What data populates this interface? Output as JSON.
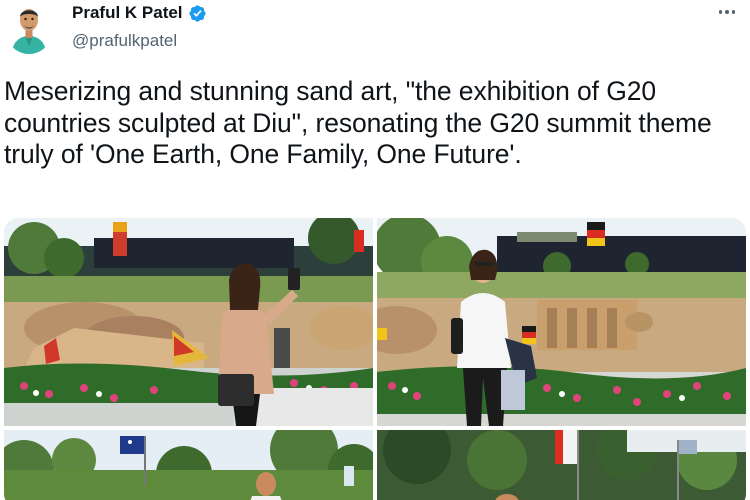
{
  "author": {
    "display_name": "Praful K Patel",
    "handle": "@prafulkpatel",
    "verified": true,
    "avatar_icon": "person-avatar"
  },
  "menu_icon": "more-options-icon",
  "tweet": {
    "text": "Meserizing and stunning sand art, \"the exhibition of G20 countries sculpted at Diu\", resonating the G20 summit theme truly of 'One Earth, One Family, One Future'."
  },
  "media": {
    "count": 4,
    "photos": [
      {
        "id": "photo-1",
        "description_icon": "sand-sculpture-woman-selfie"
      },
      {
        "id": "photo-2",
        "description_icon": "sand-sculpture-woman-standing"
      },
      {
        "id": "photo-3",
        "description_icon": "garden-man-flags"
      },
      {
        "id": "photo-4",
        "description_icon": "garden-flags"
      }
    ]
  },
  "colors": {
    "verified_blue": "#1d9bf0",
    "text_primary": "#0f1419",
    "text_secondary": "#536471"
  }
}
